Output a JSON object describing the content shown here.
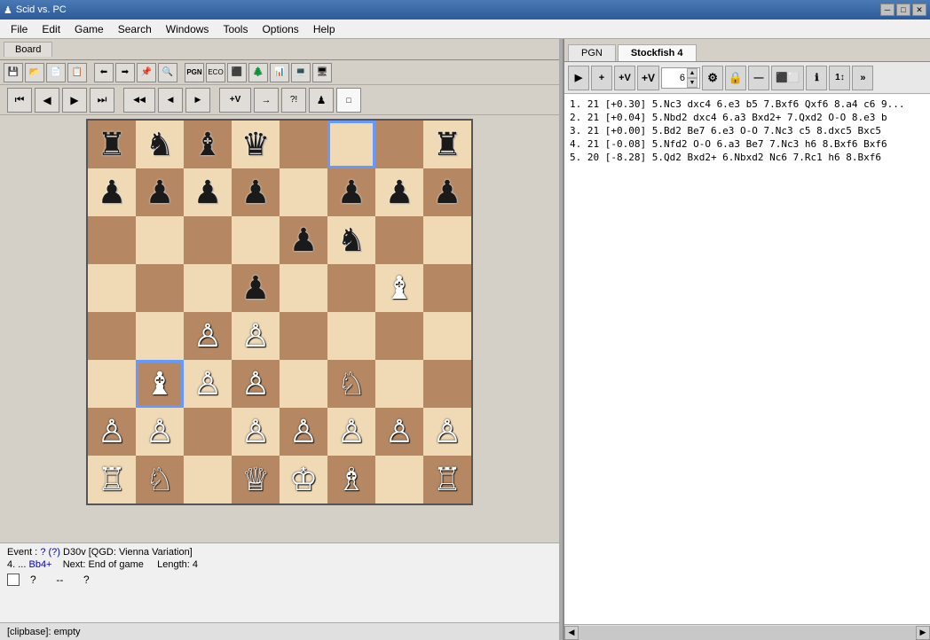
{
  "titlebar": {
    "title": "Scid vs. PC",
    "icon": "chess-icon",
    "min_label": "─",
    "max_label": "□",
    "close_label": "✕"
  },
  "menubar": {
    "items": [
      "File",
      "Edit",
      "Game",
      "Search",
      "Windows",
      "Tools",
      "Options",
      "Help"
    ]
  },
  "board": {
    "tab_label": "Board"
  },
  "toolbars": {
    "tb1_btns": [
      "💾",
      "📋",
      "📂",
      "📤",
      "⬛⬜",
      "⬛⬜",
      "⬛⬜",
      "⬛⬜",
      "⬛⬜",
      "⬛⬜"
    ],
    "tb2_btns": [
      "📄",
      "📝",
      "🔄",
      "🔀",
      "🔍",
      "🔍",
      "⚙",
      "🎯",
      "🏁",
      "🔧",
      "📊",
      "💻",
      "🖥"
    ],
    "nav_btns": [
      "⏮",
      "◀",
      "▶",
      "⏭",
      "◀◀",
      "◀",
      "▶",
      "+V",
      "→",
      "?!",
      "♟",
      "□"
    ]
  },
  "analysis": {
    "pgn_tab": "PGN",
    "engine_tab": "Stockfish 4",
    "play_btn": "▶",
    "plus_btn": "+",
    "plus_v_btn": "+V",
    "plus_v2_btn": "+V",
    "depth_value": "6",
    "lock_btn": "🔒",
    "minus_btn": "—",
    "extra_btn": "⬛⬜",
    "info_btn": "ℹ",
    "more_btn": "1↕",
    "arrow_btn": "»",
    "lines": [
      "1.  21  [+0.30]   5.Nc3 dxc4 6.e3 b5 7.Bxf6 Qxf6 8.a4 c6 9...",
      "2.  21  [+0.04]   5.Nbd2 dxc4 6.a3 Bxd2+ 7.Qxd2 O-O 8.e3 b",
      "3.  21  [+0.00]   5.Bd2 Be7 6.e3 O-O 7.Nc3 c5 8.dxc5 Bxc5",
      "4.  21  [-0.08]   5.Nfd2 O-O 6.a3 Be7 7.Nc3 h6 8.Bxf6 Bxf6",
      "5.  20  [-8.28]   5.Qd2 Bxd2+ 6.Nbxd2 Nc6 7.Rc1 h6 8.Bxf6"
    ]
  },
  "status": {
    "event_label": "Event :",
    "event_link": "?",
    "event_paren": "(?)",
    "opening": "D30v [QGD: Vienna Variation]",
    "move_label": "4.",
    "move_dots": "...",
    "move_value": "Bb4+",
    "next_label": "Next:",
    "next_value": "End of game",
    "length_label": "Length:",
    "length_value": "4",
    "nav_q1": "?",
    "nav_dash": "--",
    "nav_q2": "?",
    "clipbase": "[clipbase]:  empty"
  },
  "board_squares": [
    {
      "row": 0,
      "col": 0,
      "color": "dark",
      "piece": "♜",
      "side": "black"
    },
    {
      "row": 0,
      "col": 1,
      "color": "light",
      "piece": "♞",
      "side": "black"
    },
    {
      "row": 0,
      "col": 2,
      "color": "dark",
      "piece": "♝",
      "side": "black"
    },
    {
      "row": 0,
      "col": 3,
      "color": "light",
      "piece": "♛",
      "side": "black"
    },
    {
      "row": 0,
      "col": 4,
      "color": "dark",
      "piece": "",
      "side": ""
    },
    {
      "row": 0,
      "col": 5,
      "color": "light",
      "piece": "",
      "side": "",
      "highlight": true
    },
    {
      "row": 0,
      "col": 6,
      "color": "dark",
      "piece": "",
      "side": ""
    },
    {
      "row": 0,
      "col": 7,
      "color": "light",
      "piece": "♜",
      "side": "black"
    },
    {
      "row": 1,
      "col": 0,
      "color": "light",
      "piece": "♟",
      "side": "black"
    },
    {
      "row": 1,
      "col": 1,
      "color": "dark",
      "piece": "♟",
      "side": "black"
    },
    {
      "row": 1,
      "col": 2,
      "color": "light",
      "piece": "♟",
      "side": "black"
    },
    {
      "row": 1,
      "col": 3,
      "color": "dark",
      "piece": "♟",
      "side": "black"
    },
    {
      "row": 1,
      "col": 4,
      "color": "light",
      "piece": "",
      "side": ""
    },
    {
      "row": 1,
      "col": 5,
      "color": "dark",
      "piece": "♟",
      "side": "black"
    },
    {
      "row": 1,
      "col": 6,
      "color": "light",
      "piece": "♟",
      "side": "black"
    },
    {
      "row": 1,
      "col": 7,
      "color": "dark",
      "piece": "♟",
      "side": "black"
    },
    {
      "row": 2,
      "col": 0,
      "color": "dark",
      "piece": "",
      "side": ""
    },
    {
      "row": 2,
      "col": 1,
      "color": "light",
      "piece": "",
      "side": ""
    },
    {
      "row": 2,
      "col": 2,
      "color": "dark",
      "piece": "",
      "side": ""
    },
    {
      "row": 2,
      "col": 3,
      "color": "light",
      "piece": "",
      "side": ""
    },
    {
      "row": 2,
      "col": 4,
      "color": "dark",
      "piece": "♟",
      "side": "black"
    },
    {
      "row": 2,
      "col": 5,
      "color": "light",
      "piece": "♞",
      "side": "black"
    },
    {
      "row": 2,
      "col": 6,
      "color": "dark",
      "piece": "",
      "side": ""
    },
    {
      "row": 2,
      "col": 7,
      "color": "light",
      "piece": "",
      "side": ""
    },
    {
      "row": 3,
      "col": 0,
      "color": "light",
      "piece": "",
      "side": ""
    },
    {
      "row": 3,
      "col": 1,
      "color": "dark",
      "piece": "",
      "side": ""
    },
    {
      "row": 3,
      "col": 2,
      "color": "light",
      "piece": "",
      "side": ""
    },
    {
      "row": 3,
      "col": 3,
      "color": "dark",
      "piece": "♟",
      "side": "black"
    },
    {
      "row": 3,
      "col": 4,
      "color": "light",
      "piece": "",
      "side": ""
    },
    {
      "row": 3,
      "col": 5,
      "color": "dark",
      "piece": "",
      "side": ""
    },
    {
      "row": 3,
      "col": 6,
      "color": "light",
      "piece": "♝",
      "side": "white"
    },
    {
      "row": 3,
      "col": 7,
      "color": "dark",
      "piece": "",
      "side": ""
    },
    {
      "row": 4,
      "col": 0,
      "color": "dark",
      "piece": "",
      "side": ""
    },
    {
      "row": 4,
      "col": 1,
      "color": "light",
      "piece": "",
      "side": ""
    },
    {
      "row": 4,
      "col": 2,
      "color": "dark",
      "piece": "♙",
      "side": "white"
    },
    {
      "row": 4,
      "col": 3,
      "color": "light",
      "piece": "♙",
      "side": "white"
    },
    {
      "row": 4,
      "col": 4,
      "color": "dark",
      "piece": "",
      "side": ""
    },
    {
      "row": 4,
      "col": 5,
      "color": "light",
      "piece": "",
      "side": ""
    },
    {
      "row": 4,
      "col": 6,
      "color": "dark",
      "piece": "",
      "side": ""
    },
    {
      "row": 4,
      "col": 7,
      "color": "light",
      "piece": "",
      "side": ""
    },
    {
      "row": 5,
      "col": 0,
      "color": "light",
      "piece": "",
      "side": ""
    },
    {
      "row": 5,
      "col": 1,
      "color": "dark",
      "piece": "♝",
      "side": "white",
      "highlight": true
    },
    {
      "row": 5,
      "col": 2,
      "color": "light",
      "piece": "♙",
      "side": "white"
    },
    {
      "row": 5,
      "col": 3,
      "color": "dark",
      "piece": "♙",
      "side": "white"
    },
    {
      "row": 5,
      "col": 4,
      "color": "light",
      "piece": "",
      "side": ""
    },
    {
      "row": 5,
      "col": 5,
      "color": "dark",
      "piece": "♘",
      "side": "white"
    },
    {
      "row": 5,
      "col": 6,
      "color": "light",
      "piece": "",
      "side": ""
    },
    {
      "row": 5,
      "col": 7,
      "color": "dark",
      "piece": "",
      "side": ""
    },
    {
      "row": 6,
      "col": 0,
      "color": "dark",
      "piece": "♙",
      "side": "white"
    },
    {
      "row": 6,
      "col": 1,
      "color": "light",
      "piece": "♙",
      "side": "white"
    },
    {
      "row": 6,
      "col": 2,
      "color": "dark",
      "piece": "",
      "side": ""
    },
    {
      "row": 6,
      "col": 3,
      "color": "light",
      "piece": "♙",
      "side": "white"
    },
    {
      "row": 6,
      "col": 4,
      "color": "dark",
      "piece": "♙",
      "side": "white"
    },
    {
      "row": 6,
      "col": 5,
      "color": "light",
      "piece": "♙",
      "side": "white"
    },
    {
      "row": 6,
      "col": 6,
      "color": "dark",
      "piece": "♙",
      "side": "white"
    },
    {
      "row": 6,
      "col": 7,
      "color": "light",
      "piece": "♙",
      "side": "white"
    },
    {
      "row": 7,
      "col": 0,
      "color": "light",
      "piece": "♖",
      "side": "white"
    },
    {
      "row": 7,
      "col": 1,
      "color": "dark",
      "piece": "♘",
      "side": "white"
    },
    {
      "row": 7,
      "col": 2,
      "color": "light",
      "piece": "",
      "side": ""
    },
    {
      "row": 7,
      "col": 3,
      "color": "dark",
      "piece": "♕",
      "side": "white"
    },
    {
      "row": 7,
      "col": 4,
      "color": "light",
      "piece": "♔",
      "side": "white"
    },
    {
      "row": 7,
      "col": 5,
      "color": "dark",
      "piece": "♗",
      "side": "white"
    },
    {
      "row": 7,
      "col": 6,
      "color": "light",
      "piece": "",
      "side": ""
    },
    {
      "row": 7,
      "col": 7,
      "color": "dark",
      "piece": "♖",
      "side": "white"
    }
  ]
}
